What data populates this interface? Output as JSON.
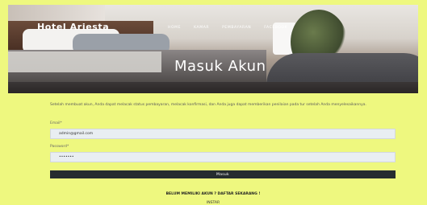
{
  "header": {
    "hotel_name": "Hotel Ariesta",
    "nav": [
      "HOME",
      "KAMAR",
      "PEMBAYARAN",
      "FACEBOOK"
    ]
  },
  "hero": {
    "title": "Masuk Akun"
  },
  "form": {
    "intro": "Setelah membuat akun, Anda dapat melacak status pembayaran, melacak konfirmasi, dan Anda juga dapat memberikan penilaian pada tur setelah Anda menyelesaikannya.",
    "email_label": "Email*",
    "email_value": "admin@gmail.com",
    "password_label": "Password*",
    "password_value": "•••••••",
    "submit_label": "Masuk"
  },
  "signup": {
    "text": "BELUM MEMILIKI AKUN ? DAFTAR SEKARANG !"
  },
  "footer": {
    "text": "INSTAR"
  }
}
